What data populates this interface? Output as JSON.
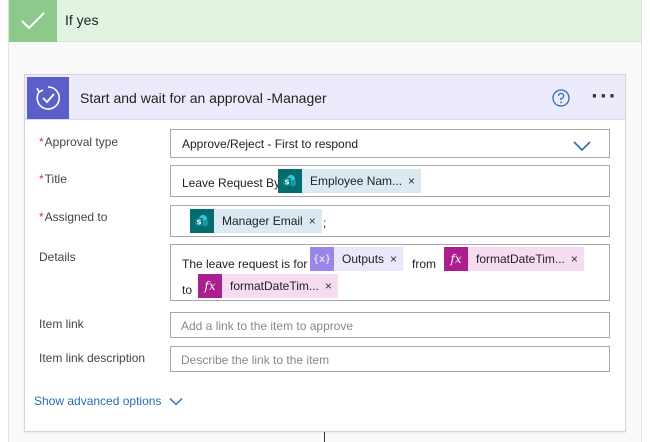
{
  "condition": {
    "label": "If yes",
    "icon": "checkmark-icon",
    "color": "#8cc98a"
  },
  "action": {
    "title": "Start and wait for an approval -Manager",
    "icon": "approval-icon",
    "help_icon": "help-icon",
    "more_icon": "more-icon",
    "more_glyph": "···",
    "accent": "#5b5fc7"
  },
  "fields": {
    "approval_type": {
      "required": "*",
      "label": "Approval type",
      "value": "Approve/Reject - First to respond"
    },
    "title": {
      "required": "*",
      "label": "Title",
      "prefix": "Leave Request By",
      "token": "Employee Nam...",
      "token_icon": "sharepoint-icon"
    },
    "assigned_to": {
      "required": "*",
      "label": "Assigned to",
      "token": "Manager Email",
      "token_icon": "sharepoint-icon",
      "suffix": ";"
    },
    "details": {
      "label": "Details",
      "text1": "The leave request is for",
      "token1": "Outputs",
      "token1_icon": "variable-icon",
      "text2": "from",
      "token2": "formatDateTim...",
      "token2_icon": "fx-icon",
      "text3": "to",
      "token3": "formatDateTim...",
      "token3_icon": "fx-icon"
    },
    "item_link": {
      "label": "Item link",
      "placeholder": "Add a link to the item to approve"
    },
    "item_link_description": {
      "label": "Item link description",
      "placeholder": "Describe the link to the item"
    }
  },
  "token_remove_glyph": "×",
  "fx_glyph": "fx",
  "var_glyph": "{x}",
  "advanced_options": {
    "label": "Show advanced options"
  }
}
